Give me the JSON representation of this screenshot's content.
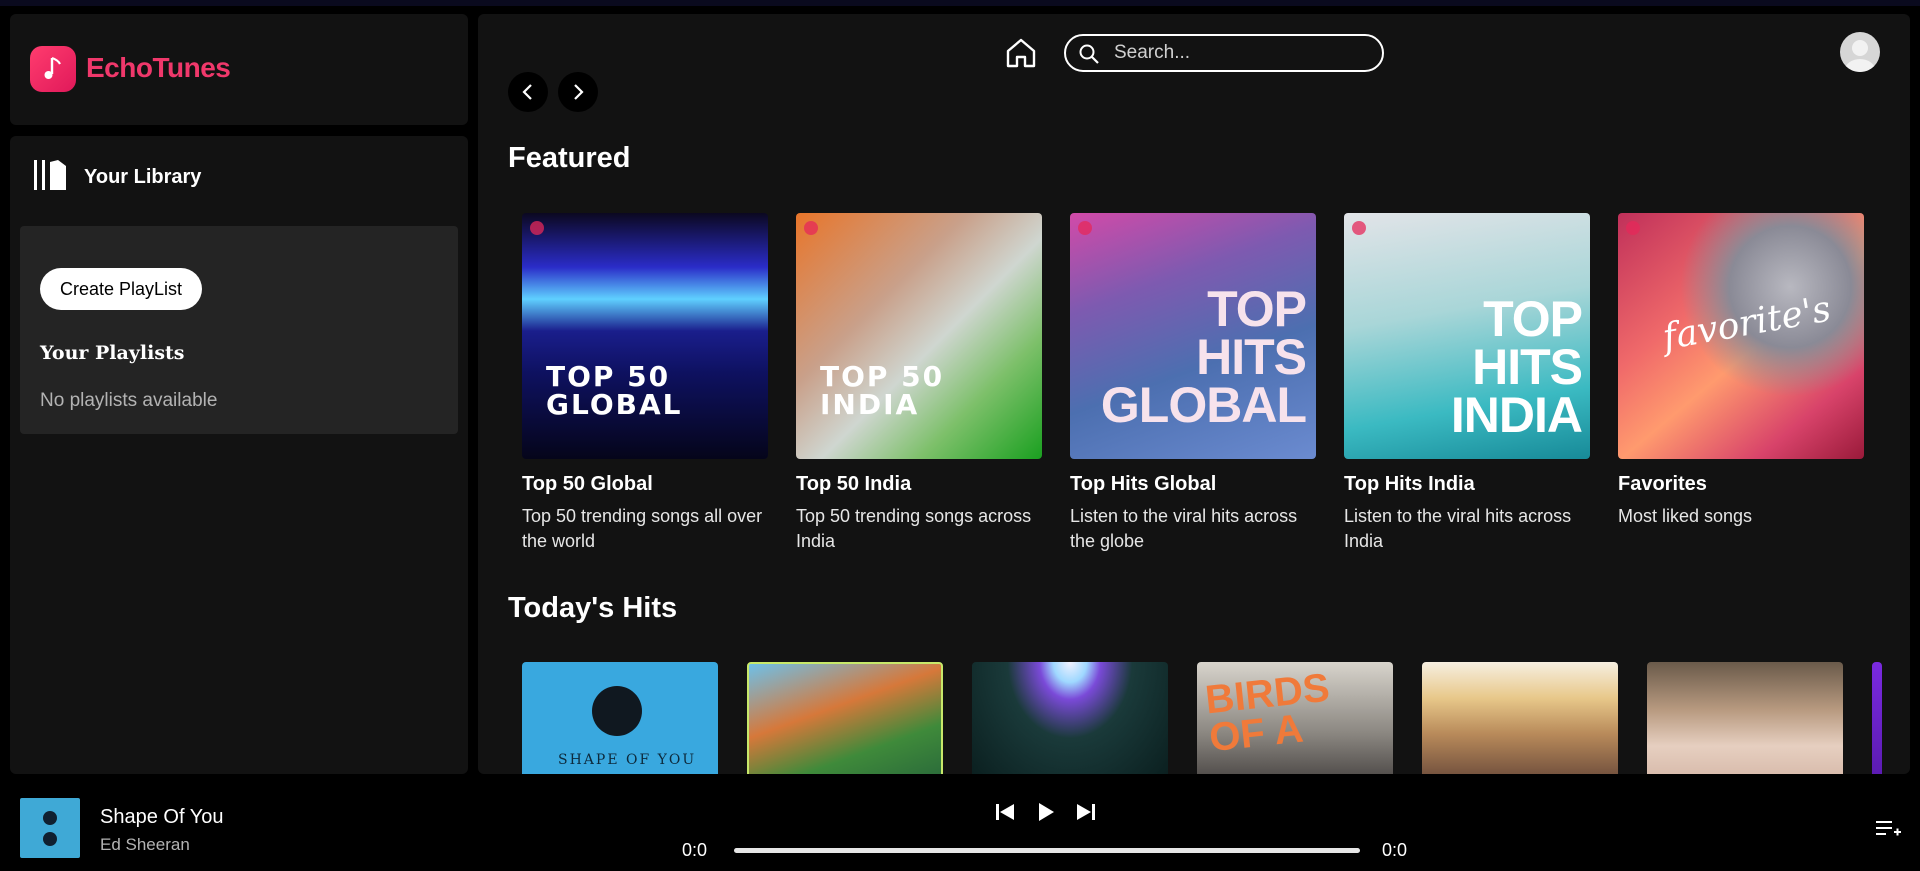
{
  "brand": {
    "name": "EchoTunes",
    "color": "#f0386b"
  },
  "library": {
    "title": "Your Library",
    "create_label": "Create PlayList",
    "playlists_heading": "Your Playlists",
    "empty_text": "No playlists available"
  },
  "header": {
    "search_placeholder": "Search...",
    "icons": [
      "home-icon",
      "search-icon",
      "avatar",
      "chevron-left-icon",
      "chevron-right-icon"
    ]
  },
  "featured": {
    "heading": "Featured",
    "cards": [
      {
        "title": "Top 50 Global",
        "desc": "Top 50 trending songs all over the world",
        "art_text": "TOP 50\nGLOBAL"
      },
      {
        "title": "Top 50 India",
        "desc": "Top 50 trending songs across India",
        "art_text": "TOP 50\nINDIA"
      },
      {
        "title": "Top Hits Global",
        "desc": "Listen to the viral hits across the globe",
        "art_text": "TOP\nHITS\nGLOBAL"
      },
      {
        "title": "Top Hits India",
        "desc": "Listen to the viral hits across India",
        "art_text": "TOP\nHITS\nINDIA"
      },
      {
        "title": "Favorites",
        "desc": "Most liked songs",
        "art_text": "favorite's"
      }
    ]
  },
  "todays_hits": {
    "heading": "Today's Hits",
    "album_text": [
      "SHAPE OF YOU",
      "BIRDS OF A"
    ]
  },
  "player": {
    "title": "Shape Of You",
    "artist": "Ed Sheeran",
    "current_time": "0:0",
    "duration": "0:0",
    "progress": 0
  }
}
